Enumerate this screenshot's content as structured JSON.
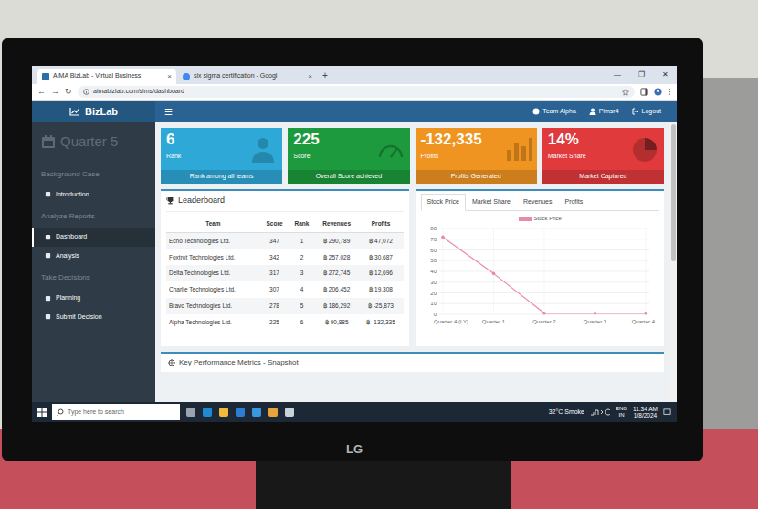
{
  "browser": {
    "tabs": [
      {
        "label": "AIMA BizLab - Virtual Business",
        "selected": true,
        "close": "×"
      },
      {
        "label": "six sigma certification - Googl",
        "selected": false,
        "close": "×"
      }
    ],
    "new_tab": "+",
    "controls": [
      "—",
      "❐",
      "✕"
    ],
    "nav": [
      "←",
      "→",
      "↻"
    ],
    "address": "aimabizlab.com/sims/dashboard"
  },
  "app": {
    "brand": "BizLab",
    "menu": "☰",
    "user_links": [
      {
        "label": "Team Alpha"
      },
      {
        "label": "Pimsr4"
      },
      {
        "label": "Logout"
      }
    ]
  },
  "sidebar": {
    "quarter": "Quarter 5",
    "sections": [
      {
        "title": "Background Case",
        "items": [
          {
            "label": "Introduction",
            "selected": false
          }
        ]
      },
      {
        "title": "Analyze Reports",
        "items": [
          {
            "label": "Dashboard",
            "selected": true
          },
          {
            "label": "Analysis",
            "selected": false
          }
        ]
      },
      {
        "title": "Take Decisions",
        "items": [
          {
            "label": "Planning",
            "selected": false
          },
          {
            "label": "Submit Decision",
            "selected": false
          }
        ]
      }
    ]
  },
  "cards": [
    {
      "value": "6",
      "label": "Rank",
      "footer": "Rank among all teams",
      "color": "#2ea9d7",
      "kind": "person"
    },
    {
      "value": "225",
      "label": "Score",
      "footer": "Overall Score achieved",
      "color": "#1e9a3e",
      "kind": "gauge"
    },
    {
      "value": "-132,335",
      "label": "Profits",
      "footer": "Profits Generated",
      "color": "#ef9420",
      "kind": "bars"
    },
    {
      "value": "14%",
      "label": "Market Share",
      "footer": "Market Captured",
      "color": "#e13a3d",
      "kind": "pie"
    }
  ],
  "leaderboard": {
    "title": "Leaderboard",
    "columns": [
      "Team",
      "Score",
      "Rank",
      "Revenues",
      "Profits"
    ],
    "rows": [
      [
        "Echo Technologies Ltd.",
        "347",
        "1",
        "฿ 290,789",
        "฿ 47,072"
      ],
      [
        "Foxtrot Technologies Ltd.",
        "342",
        "2",
        "฿ 257,028",
        "฿ 30,687"
      ],
      [
        "Delta Technologies Ltd.",
        "317",
        "3",
        "฿ 272,745",
        "฿ 12,696"
      ],
      [
        "Charlie Technologies Ltd.",
        "307",
        "4",
        "฿ 206,452",
        "฿ 19,308"
      ],
      [
        "Bravo Technologies Ltd.",
        "278",
        "5",
        "฿ 186,292",
        "฿ -25,873"
      ],
      [
        "Alpha Technologies Ltd.",
        "225",
        "6",
        "฿ 90,885",
        "฿ -132,335"
      ]
    ]
  },
  "chart": {
    "tabs": [
      {
        "label": "Stock Price",
        "selected": true
      },
      {
        "label": "Market Share",
        "selected": false
      },
      {
        "label": "Revenues",
        "selected": false
      },
      {
        "label": "Profits",
        "selected": false
      }
    ],
    "y_ticks": [
      "80",
      "70",
      "60",
      "50",
      "40",
      "30",
      "20",
      "10",
      "0"
    ],
    "x_labels": [
      "Quarter 4 (LY)",
      "Quarter 1",
      "Quarter 2",
      "Quarter 3",
      "Quarter 4"
    ],
    "series": [
      {
        "name": "Stock Price",
        "values": [
          72,
          38,
          1,
          1,
          1
        ],
        "color": "#e98aa8"
      }
    ]
  },
  "snapshot": {
    "title": "Key Performance Metrics - Snapshot"
  },
  "taskbar": {
    "search": "Type here to search",
    "weather": "32°C Smoke",
    "language": [
      "ENG",
      "IN"
    ],
    "time": "11:34 AM",
    "date": "1/8/2024"
  },
  "monitor": {
    "brand": "LG"
  }
}
